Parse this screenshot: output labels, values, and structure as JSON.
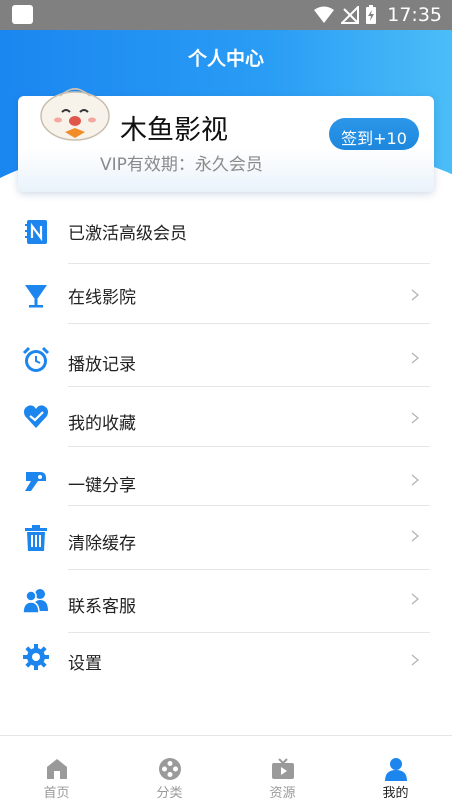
{
  "status_bar": {
    "time": "17:35"
  },
  "header": {
    "title": "个人中心"
  },
  "profile": {
    "name": "木鱼影视",
    "vip_text": "VIP有效期：永久会员",
    "signin_label": "签到+10"
  },
  "menu": {
    "items": [
      {
        "label": "已激活高级会员",
        "icon": "vip-notebook-icon",
        "has_chevron": false
      },
      {
        "label": "在线影院",
        "icon": "cinema-cup-icon",
        "has_chevron": true
      },
      {
        "label": "播放记录",
        "icon": "alarm-clock-icon",
        "has_chevron": true
      },
      {
        "label": "我的收藏",
        "icon": "heart-icon",
        "has_chevron": true
      },
      {
        "label": "一键分享",
        "icon": "share-icon",
        "has_chevron": true
      },
      {
        "label": "清除缓存",
        "icon": "trash-icon",
        "has_chevron": true
      },
      {
        "label": "联系客服",
        "icon": "contacts-icon",
        "has_chevron": true
      },
      {
        "label": "设置",
        "icon": "gear-icon",
        "has_chevron": true
      }
    ]
  },
  "bottom_nav": {
    "tabs": [
      {
        "label": "首页",
        "icon": "home-icon",
        "active": false
      },
      {
        "label": "分类",
        "icon": "category-icon",
        "active": false
      },
      {
        "label": "资源",
        "icon": "tv-icon",
        "active": false
      },
      {
        "label": "我的",
        "icon": "user-icon",
        "active": true
      }
    ]
  },
  "colors": {
    "accent": "#1a86f0",
    "icon_blue": "#1c86ee",
    "inactive": "#9a9a9a"
  }
}
